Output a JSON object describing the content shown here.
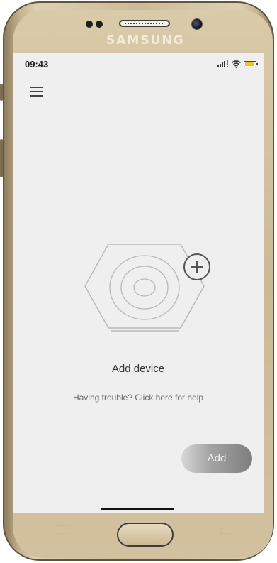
{
  "device": {
    "brand": "SAMSUNG"
  },
  "status_bar": {
    "time": "09:43",
    "battery_color": "#f1c40f"
  },
  "toolbar": {
    "menu_icon": "hamburger-menu-icon"
  },
  "main": {
    "illustration_icon": "smart-device-add-icon",
    "title": "Add device",
    "help_link": "Having trouble? Click here for help",
    "add_button_label": "Add"
  },
  "colors": {
    "screen_background": "#efefef",
    "button_gradient_start": "#d8d8d8",
    "button_gradient_end": "#7e7e7e",
    "phone_frame": "#cdbb96"
  }
}
